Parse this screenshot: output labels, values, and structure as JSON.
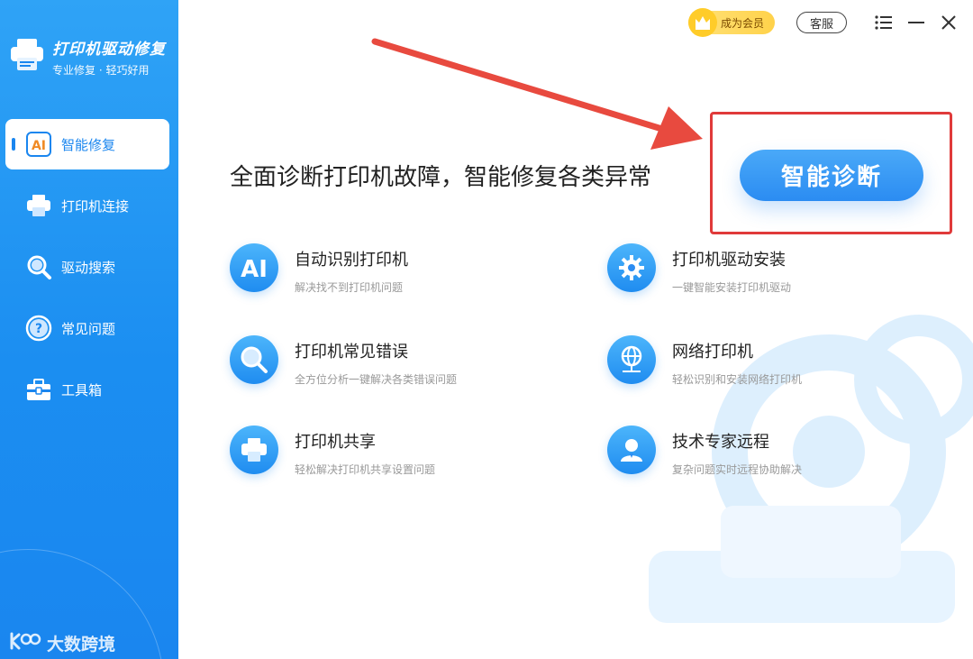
{
  "app": {
    "title": "打印机驱动修复",
    "subtitle": "专业修复 · 轻巧好用"
  },
  "sidebar": {
    "items": [
      {
        "label": "智能修复",
        "icon": "ai-icon",
        "active": true
      },
      {
        "label": "打印机连接",
        "icon": "printer-icon",
        "active": false
      },
      {
        "label": "驱动搜索",
        "icon": "search-icon",
        "active": false
      },
      {
        "label": "常见问题",
        "icon": "question-icon",
        "active": false
      },
      {
        "label": "工具箱",
        "icon": "toolbox-icon",
        "active": false
      }
    ],
    "footer": "大数跨境"
  },
  "topbar": {
    "vip_label": "成为会员",
    "service_label": "客服"
  },
  "main": {
    "headline": "全面诊断打印机故障，智能修复各类异常",
    "diagnose_label": "智能诊断",
    "features": [
      {
        "title": "自动识别打印机",
        "desc": "解决找不到打印机问题",
        "icon": "ai-icon"
      },
      {
        "title": "打印机驱动安装",
        "desc": "一键智能安装打印机驱动",
        "icon": "gear-icon"
      },
      {
        "title": "打印机常见错误",
        "desc": "全方位分析一键解决各类错误问题",
        "icon": "search-icon"
      },
      {
        "title": "网络打印机",
        "desc": "轻松识别和安装网络打印机",
        "icon": "network-icon"
      },
      {
        "title": "打印机共享",
        "desc": "轻松解决打印机共享设置问题",
        "icon": "printer-icon"
      },
      {
        "title": "技术专家远程",
        "desc": "复杂问题实时远程协助解决",
        "icon": "expert-icon"
      }
    ]
  },
  "colors": {
    "accent": "#1a86ef",
    "highlight": "#e03a3a",
    "vip": "#ffd24a"
  }
}
